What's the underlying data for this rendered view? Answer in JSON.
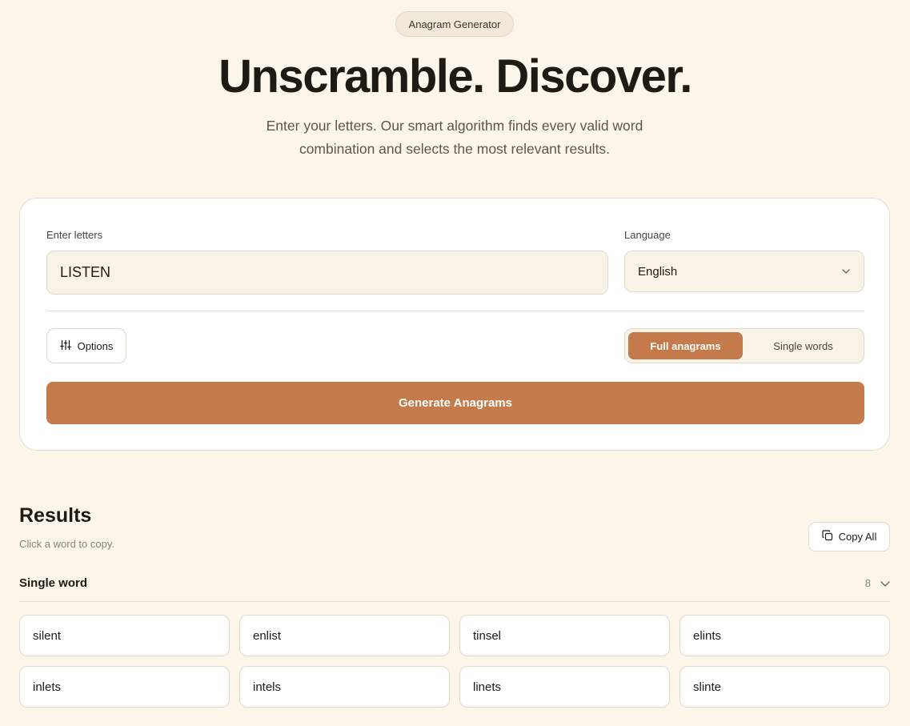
{
  "header": {
    "pill": "Anagram Generator",
    "title": "Unscramble. Discover.",
    "subtitle": "Enter your letters. Our smart algorithm finds every valid word combination and selects the most relevant results."
  },
  "form": {
    "letters_label": "Enter letters",
    "letters_value": "LISTEN",
    "language_label": "Language",
    "language_value": "English",
    "options_label": "Options",
    "modes": [
      "Full anagrams",
      "Single words"
    ],
    "active_mode": "Full anagrams",
    "generate_label": "Generate Anagrams"
  },
  "results": {
    "title": "Results",
    "subtitle": "Click a word to copy.",
    "copy_all_label": "Copy All",
    "group_title": "Single word",
    "group_count": "8",
    "words": [
      "silent",
      "enlist",
      "tinsel",
      "elints",
      "inlets",
      "intels",
      "linets",
      "slinte"
    ]
  },
  "colors": {
    "accent": "#c47a4a",
    "background": "#fbf5ea"
  }
}
